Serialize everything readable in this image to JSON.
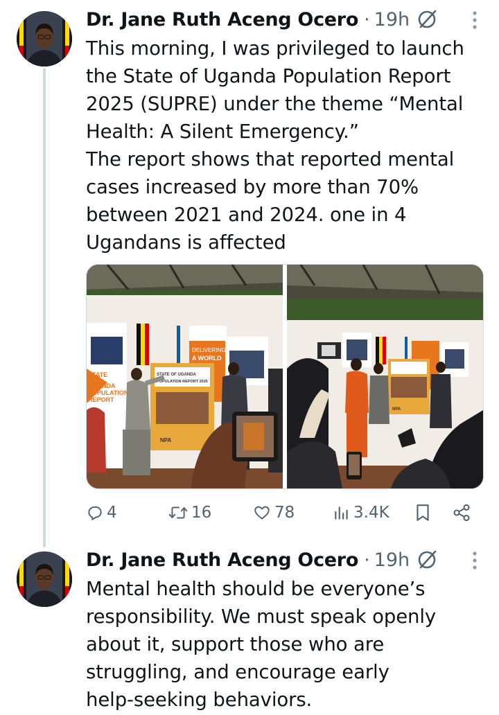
{
  "tweets": [
    {
      "author": "Dr. Jane Ruth Aceng Ocero",
      "separator": "·",
      "time": "19h",
      "text": "This morning, I was privileged to launch\nthe State of Uganda Population Report\n2025 (SUPRE) under the theme “Mental\nHealth: A Silent Emergency.”\nThe report shows that reported mental\ncases increased by more than 70%\nbetween 2021 and 2024. one in 4\nUgandans is affected",
      "media": [
        {
          "banner_lines": [
            "DELIVERING",
            "A WORLD"
          ],
          "poster_lines": [
            "STATE",
            "UGANDA",
            "POPULATION",
            "REPORT"
          ],
          "report_cover": [
            "STATE OF UGANDA",
            "POPULATION REPORT 2025"
          ],
          "logo": "NPA"
        },
        {
          "logo": "NPA"
        }
      ],
      "actions": {
        "replies": "4",
        "reposts": "16",
        "likes": "78",
        "views": "3.4K"
      }
    },
    {
      "author": "Dr. Jane Ruth Aceng Ocero",
      "separator": "·",
      "time": "19h",
      "text": "Mental health should be everyone’s\nresponsibility. We must speak openly\nabout it, support those who are\nstruggling, and encourage early\nhelp-seeking behaviors."
    }
  ],
  "icons": {
    "reply": "reply-icon",
    "repost": "repost-icon",
    "like": "like-icon",
    "views": "views-icon",
    "bookmark": "bookmark-icon",
    "share": "share-icon",
    "grok": "grok-icon",
    "more": "more-icon"
  },
  "colors": {
    "text": "#0f1419",
    "secondary": "#536471",
    "thread_line": "#cfd9de",
    "banner_orange": "#e8761f",
    "uganda_black": "#000000",
    "uganda_yellow": "#fcdc04",
    "uganda_red": "#d90000"
  }
}
